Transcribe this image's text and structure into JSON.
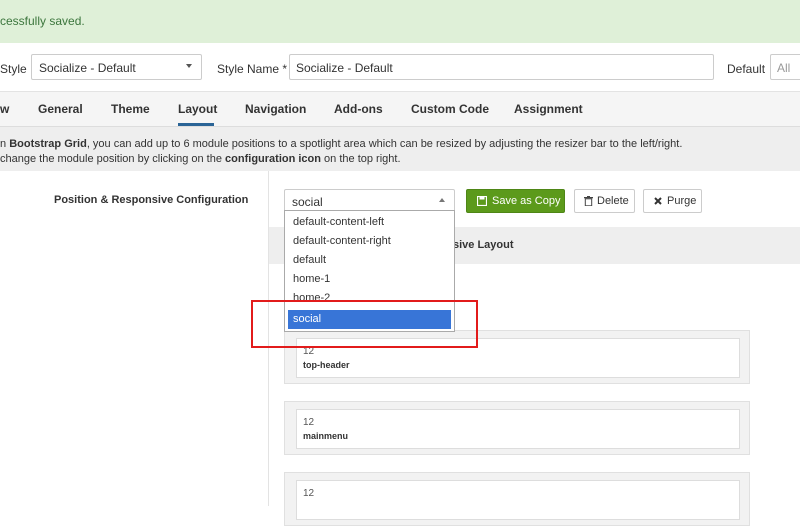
{
  "alert": {
    "message": "cessfully saved."
  },
  "style_row": {
    "style_label": "Style",
    "style_value": "Socialize - Default",
    "style_name_label": "Style Name *",
    "style_name_value": "Socialize - Default",
    "default_label": "Default",
    "default_value": "All"
  },
  "tabs": [
    {
      "label": "w"
    },
    {
      "label": "General"
    },
    {
      "label": "Theme"
    },
    {
      "label": "Layout"
    },
    {
      "label": "Navigation"
    },
    {
      "label": "Add-ons"
    },
    {
      "label": "Custom Code"
    },
    {
      "label": "Assignment"
    }
  ],
  "active_tab": "Layout",
  "info": {
    "line1_pre": "n ",
    "line1_bold": "Bootstrap Grid",
    "line1_post": ", you can add up to 6 module positions to a spotlight area which can be resized by adjusting the resizer bar to the left/right.",
    "line2_pre": "change the module position by clicking on the ",
    "line2_bold": "configuration icon",
    "line2_post": " on the top right."
  },
  "position_label": "Position & Responsive Configuration",
  "position_select": {
    "value": "social"
  },
  "buttons": {
    "save_copy": "Save as Copy",
    "delete": "Delete",
    "purge": "Purge"
  },
  "panel_heading": "sive Layout",
  "dropdown": {
    "options": [
      "default-content-left",
      "default-content-right",
      "default",
      "home-1",
      "home-2",
      "social"
    ],
    "selected": "social"
  },
  "rows": [
    {
      "cols": "12",
      "name": "top-header"
    },
    {
      "cols": "12",
      "name": "mainmenu"
    },
    {
      "cols": "12",
      "name": ""
    }
  ],
  "colors": {
    "success_bg": "#dff0d8",
    "success_text": "#3c763d",
    "accent_green": "#5c9a1b",
    "tab_underline": "#2a6496",
    "dropdown_selected": "#3875d7",
    "highlight_red": "#e21b1b"
  },
  "icons": {
    "save_copy": "floppy-disk-icon",
    "delete": "trash-icon",
    "purge": "close-x-icon"
  }
}
